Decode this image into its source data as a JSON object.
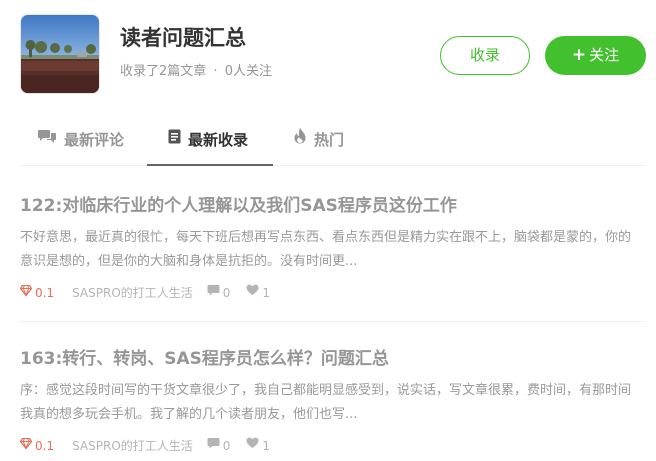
{
  "collection": {
    "title": "读者问题汇总",
    "article_count_text": "收录了2篇文章",
    "separator": "·",
    "followers_text": "0人关注"
  },
  "actions": {
    "collect_label": "收录",
    "follow_icon": "+",
    "follow_label": "关注"
  },
  "tabs": [
    {
      "label": "最新评论",
      "icon": "comments-icon",
      "active": false
    },
    {
      "label": "最新收录",
      "icon": "document-icon",
      "active": true
    },
    {
      "label": "热门",
      "icon": "fire-icon",
      "active": false
    }
  ],
  "notes": [
    {
      "title": "122:对临床行业的个人理解以及我们SAS程序员这份工作",
      "abstract": "不好意思，最近真的很忙，每天下班后想再写点东西、看点东西但是精力实在跟不上，脑袋都是蒙的，你的意识是想的，但是你的大脑和身体是抗拒的。没有时间更...",
      "diamond": "0.1",
      "author": "SASPRO的打工人生活",
      "comments": "0",
      "likes": "1"
    },
    {
      "title": "163:转行、转岗、SAS程序员怎么样？问题汇总",
      "abstract": "序：感觉这段时间写的干货文章很少了，我自己都能明显感受到，说实话，写文章很累，费时间，有那时间我真的想多玩会手机。我了解的几个读者朋友，他们也写...",
      "diamond": "0.1",
      "author": "SASPRO的打工人生活",
      "comments": "0",
      "likes": "1"
    }
  ],
  "colors": {
    "brand_green": "#42c02e",
    "diamond_red": "#ea6f5a",
    "muted_text": "#969696"
  }
}
